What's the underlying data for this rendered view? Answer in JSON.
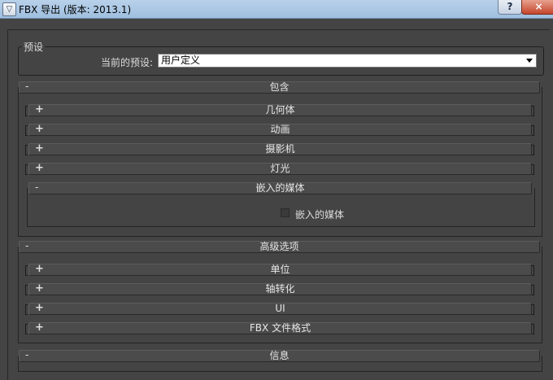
{
  "window": {
    "title": "FBX 导出 (版本: 2013.1)",
    "help_label": "?",
    "close_label": "×",
    "icon_name": "max-app-icon"
  },
  "preset": {
    "group_label": "预设",
    "current_label": "当前的预设:",
    "current_value": "用户定义"
  },
  "include": {
    "header": "包含",
    "header_sign": "-",
    "items": [
      {
        "label": "几何体",
        "sign": "+"
      },
      {
        "label": "动画",
        "sign": "+"
      },
      {
        "label": "摄影机",
        "sign": "+"
      },
      {
        "label": "灯光",
        "sign": "+"
      }
    ],
    "embed": {
      "header": "嵌入的媒体",
      "sign": "-",
      "checkbox_label": "嵌入的媒体",
      "checked": false
    }
  },
  "advanced": {
    "header": "高级选项",
    "header_sign": "-",
    "items": [
      {
        "label": "单位",
        "sign": "+"
      },
      {
        "label": "轴转化",
        "sign": "+"
      },
      {
        "label": "UI",
        "sign": "+"
      },
      {
        "label": "FBX 文件格式",
        "sign": "+"
      }
    ]
  },
  "info": {
    "header": "信息",
    "header_sign": "-"
  },
  "colors": {
    "panel_bg": "#444444",
    "titlebar": "#b9d1ea",
    "close_button": "#c4452b"
  }
}
